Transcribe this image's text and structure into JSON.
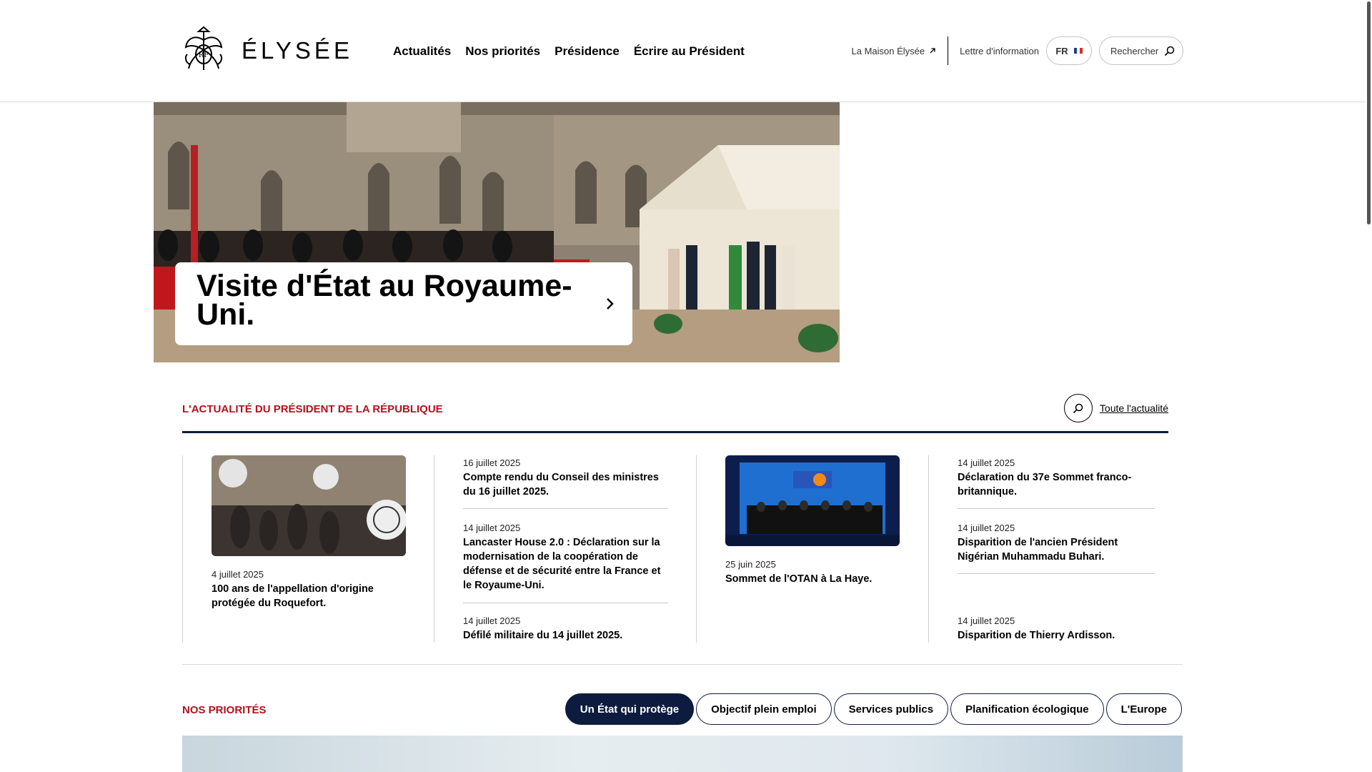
{
  "header": {
    "logo_text": "ÉLYSÉE",
    "nav": [
      "Actualités",
      "Nos priorités",
      "Présidence",
      "Écrire au Président"
    ],
    "maison_link": "La Maison Élysée",
    "newsletter_link": "Lettre d'information",
    "lang": "FR",
    "search_label": "Rechercher"
  },
  "hero": {
    "title": "Visite d'État au Royaume-Uni."
  },
  "news": {
    "section_title": "L'ACTUALITÉ DU PRÉSIDENT DE LA RÉPUBLIQUE",
    "all_news_link": "Toute l'actualité",
    "col1": {
      "date": "4 juillet 2025",
      "title": "100 ans de l'appellation d'origine protégée du Roquefort."
    },
    "col2": [
      {
        "date": "16 juillet 2025",
        "title": "Compte rendu du Conseil des ministres du 16 juillet 2025."
      },
      {
        "date": "14 juillet 2025",
        "title": "Lancaster House 2.0 : Déclaration sur la modernisation de la coopération de défense et de sécurité entre la France et le Royaume-Uni."
      },
      {
        "date": "14 juillet 2025",
        "title": "Défilé militaire du 14 juillet 2025."
      }
    ],
    "col3": {
      "date": "25 juin 2025",
      "title": "Sommet de l'OTAN à La Haye."
    },
    "col4": [
      {
        "date": "14 juillet 2025",
        "title": "Déclaration du 37e Sommet franco-britannique."
      },
      {
        "date": "14 juillet 2025",
        "title": "Disparition de l'ancien Président Nigérian Muhammadu Buhari."
      },
      {
        "date": "14 juillet 2025",
        "title": "Disparition de Thierry Ardisson."
      }
    ]
  },
  "priorities": {
    "section_title": "NOS PRIORITÉS",
    "tabs": [
      "Un État qui protège",
      "Objectif plein emploi",
      "Services publics",
      "Planification écologique",
      "L'Europe"
    ],
    "active_tab": "Un État qui protège"
  },
  "colors": {
    "accent_red": "#b3121d",
    "navy": "#0d1b3e"
  }
}
